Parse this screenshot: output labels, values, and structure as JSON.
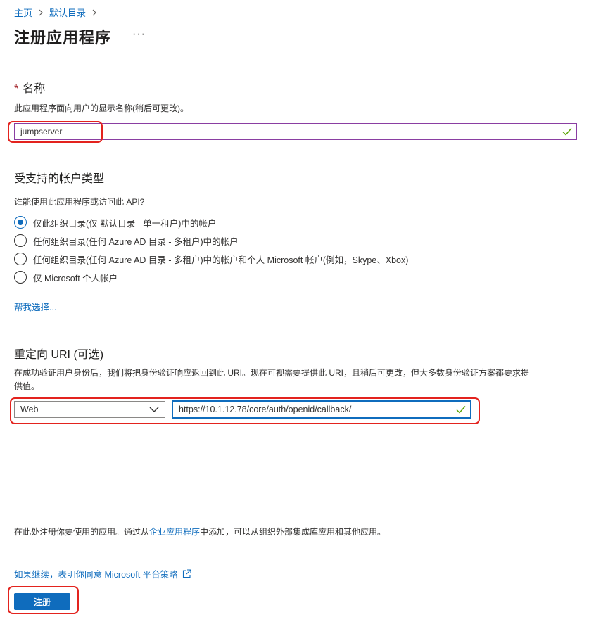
{
  "breadcrumb": [
    {
      "label": "主页"
    },
    {
      "label": "默认目录"
    }
  ],
  "page": {
    "title": "注册应用程序",
    "more_label": "···"
  },
  "name_section": {
    "required_mark": "*",
    "title": "名称",
    "description": "此应用程序面向用户的显示名称(稍后可更改)。",
    "value": "jumpserver"
  },
  "account_section": {
    "title": "受支持的帐户类型",
    "question": "谁能使用此应用程序或访问此 API?",
    "options": [
      {
        "label": "仅此组织目录(仅 默认目录 - 单一租户)中的帐户",
        "checked": true
      },
      {
        "label": "任何组织目录(任何 Azure AD 目录 - 多租户)中的帐户",
        "checked": false
      },
      {
        "label": "任何组织目录(任何 Azure AD 目录 - 多租户)中的帐户和个人 Microsoft 帐户(例如，Skype、Xbox)",
        "checked": false
      },
      {
        "label": "仅 Microsoft 个人帐户",
        "checked": false
      }
    ],
    "help_link": "帮我选择..."
  },
  "redirect_section": {
    "title": "重定向 URI (可选)",
    "description_line1": "在成功验证用户身份后，我们将把身份验证响应返回到此 URI。现在可视需要提供此 URI，且稍后可更改，但大多数身份验证方案都要求提",
    "description_line2": "供值。",
    "platform": "Web",
    "uri": "https://10.1.12.78/core/auth/openid/callback/"
  },
  "footer": {
    "note_prefix": "在此处注册你要使用的应用。通过从",
    "note_link": "企业应用程序",
    "note_suffix": "中添加，可以从组织外部集成库应用和其他应用。",
    "policy_link": "如果继续，表明你同意 Microsoft 平台策略",
    "register_button": "注册"
  },
  "colors": {
    "accent": "#0f6cbd",
    "highlight": "#e3231e",
    "valid_check": "#57a300"
  },
  "icons": [
    "chevron-right-icon",
    "checkmark-icon",
    "chevron-down-icon",
    "external-link-icon"
  ]
}
